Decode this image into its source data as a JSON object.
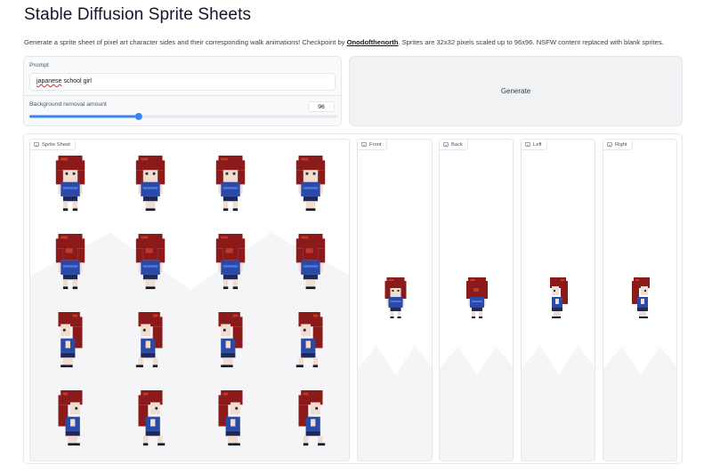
{
  "app": {
    "title": "Stable Diffusion Sprite Sheets",
    "description_before": "Generate a sprite sheet of pixel art character sides and their corresponding walk animations! Checkpoint by ",
    "description_link": "Onodofthenorth",
    "description_after": ". Sprites are 32x32 pixels scaled up to 96x96. NSFW content replaced with blank sprites."
  },
  "form": {
    "prompt_label": "Prompt",
    "prompt_value_misspelled": "japanese",
    "prompt_value_rest": " school girl",
    "bg_label": "Background removal amount",
    "bg_value": "96",
    "bg_fraction": 0.355
  },
  "generate_label": "Generate",
  "outputs": {
    "sprite_sheet_label": "Sprite Sheet",
    "front_label": "Front",
    "back_label": "Back",
    "left_label": "Left",
    "right_label": "Right"
  },
  "colors": {
    "hair": "#8b1a1a",
    "hair_light": "#c0392b",
    "shirt": "#2a4aa8",
    "skin": "#f2dcd0",
    "accent": "#3b82f6",
    "bg_fade": "#f5f5f8"
  },
  "icons": {
    "image_tag_icon": "image-icon"
  }
}
